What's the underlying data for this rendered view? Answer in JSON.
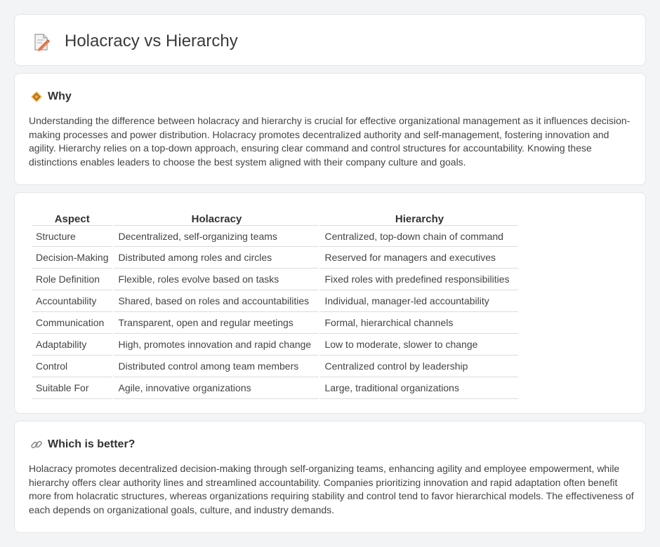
{
  "header": {
    "title": "Holacracy vs Hierarchy",
    "icon": "document-edit-icon"
  },
  "why": {
    "heading": "Why",
    "icon": "diamond-sign-icon",
    "body": "Understanding the difference between holacracy and hierarchy is crucial for effective organizational management as it influences decision-making processes and power distribution. Holacracy promotes decentralized authority and self-management, fostering innovation and agility. Hierarchy relies on a top-down approach, ensuring clear command and control structures for accountability. Knowing these distinctions enables leaders to choose the best system aligned with their company culture and goals."
  },
  "comparison": {
    "columns": [
      "Aspect",
      "Holacracy",
      "Hierarchy"
    ],
    "rows": [
      {
        "aspect": "Structure",
        "holacracy": "Decentralized, self-organizing teams",
        "hierarchy": "Centralized, top-down chain of command"
      },
      {
        "aspect": "Decision-Making",
        "holacracy": "Distributed among roles and circles",
        "hierarchy": "Reserved for managers and executives"
      },
      {
        "aspect": "Role Definition",
        "holacracy": "Flexible, roles evolve based on tasks",
        "hierarchy": "Fixed roles with predefined responsibilities"
      },
      {
        "aspect": "Accountability",
        "holacracy": "Shared, based on roles and accountabilities",
        "hierarchy": "Individual, manager-led accountability"
      },
      {
        "aspect": "Communication",
        "holacracy": "Transparent, open and regular meetings",
        "hierarchy": "Formal, hierarchical channels"
      },
      {
        "aspect": "Adaptability",
        "holacracy": "High, promotes innovation and rapid change",
        "hierarchy": "Low to moderate, slower to change"
      },
      {
        "aspect": "Control",
        "holacracy": "Distributed control among team members",
        "hierarchy": "Centralized control by leadership"
      },
      {
        "aspect": "Suitable For",
        "holacracy": "Agile, innovative organizations",
        "hierarchy": "Large, traditional organizations"
      }
    ]
  },
  "better": {
    "heading": "Which is better?",
    "icon": "link-icon",
    "body": "Holacracy promotes decentralized decision-making through self-organizing teams, enhancing agility and employee empowerment, while hierarchy offers clear authority lines and streamlined accountability. Companies prioritizing innovation and rapid adaptation often benefit more from holacratic structures, whereas organizations requiring stability and control tend to favor hierarchical models. The effectiveness of each depends on organizational goals, culture, and industry demands."
  }
}
